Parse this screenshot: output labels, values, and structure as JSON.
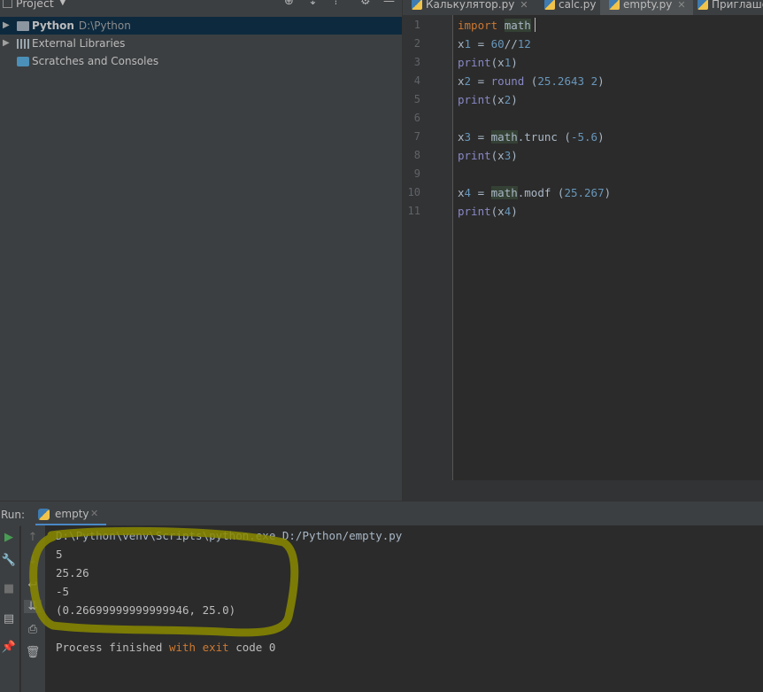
{
  "project_panel": {
    "title": "Project",
    "items": [
      {
        "label": "Python",
        "path": "D:\\Python"
      },
      {
        "label": "External Libraries",
        "path": ""
      },
      {
        "label": "Scratches and Consoles",
        "path": ""
      }
    ]
  },
  "tabs": [
    {
      "label": "Калькулятор.py"
    },
    {
      "label": "calc.py"
    },
    {
      "label": "empty.py"
    },
    {
      "label": "Приглаше"
    }
  ],
  "editor": {
    "line_numbers": [
      "1",
      "2",
      "3",
      "4",
      "5",
      "6",
      "7",
      "8",
      "9",
      "10",
      "11"
    ],
    "lines": [
      "import math",
      "x1 = 60//12",
      "print(x1)",
      "x2 = round (25.2643 2)",
      "print(x2)",
      "",
      "x3 = math.trunc (-5.6)",
      "print(x3)",
      "",
      "x4 = math.modf (25.267)",
      "print(x4)"
    ]
  },
  "run_panel": {
    "label": "Run:",
    "tab_label": "empty",
    "output": [
      "D:\\Python\\venv\\Scripts\\python.exe D:/Python/empty.py",
      "5",
      "25.26",
      "-5",
      "(0.26699999999999946, 25.0)",
      "",
      "Process finished with exit code 0"
    ]
  },
  "colors": {
    "accent": "#4a88c7",
    "keyword": "#cc7832",
    "number": "#6897bb",
    "builtin": "#8888c6",
    "annotation": "#b8b800"
  }
}
